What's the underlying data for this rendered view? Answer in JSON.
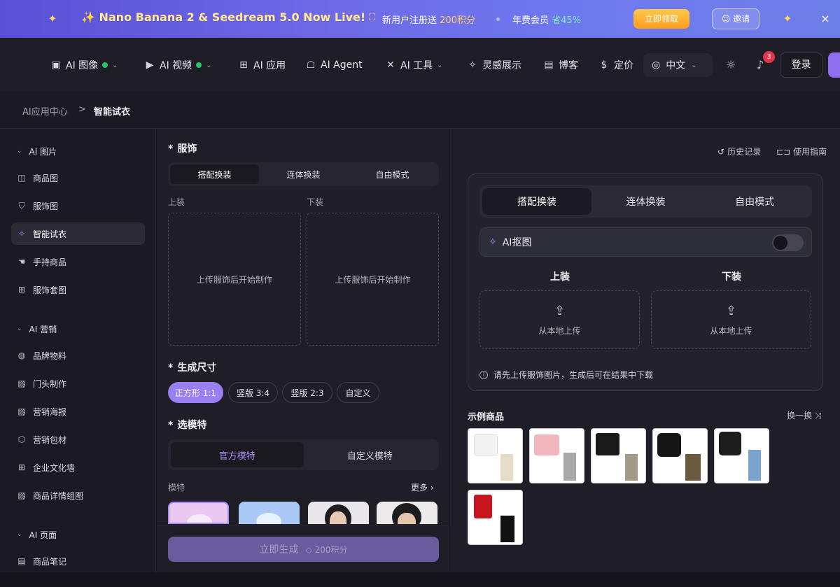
{
  "banner": {
    "title": "✨ Nano Banana 2 & Seedream 5.0 Now Live!",
    "gift_text": "新用户注册送",
    "gift_points": "200积分",
    "vip_text": "年费会员",
    "vip_discount": "省45%",
    "claim_label": "立即领取",
    "invite_label": "邀请",
    "close_icon": "×"
  },
  "nav": {
    "items": [
      {
        "label": "AI 图像",
        "icon": "image-icon"
      },
      {
        "label": "AI 视频",
        "icon": "video-icon"
      },
      {
        "label": "AI 应用",
        "icon": "apps-icon"
      },
      {
        "label": "AI Agent",
        "icon": "robot-icon"
      },
      {
        "label": "AI 工具",
        "icon": "tools-icon"
      },
      {
        "label": "灵感展示",
        "icon": "sparkle-icon"
      },
      {
        "label": "博客",
        "icon": "document-icon"
      },
      {
        "label": "定价",
        "icon": "dollar-icon"
      }
    ],
    "language": "中文",
    "notification_count": "3",
    "login_label": "登录"
  },
  "breadcrumb": {
    "parent": "AI应用中心",
    "separator": ">",
    "current": "智能试衣"
  },
  "sidebar": {
    "sections": [
      {
        "title": "AI 图片",
        "items": [
          {
            "label": "商品图",
            "icon": "bag-icon"
          },
          {
            "label": "服饰图",
            "icon": "shirt-icon"
          },
          {
            "label": "智能试衣",
            "icon": "magic-icon",
            "active": true
          },
          {
            "label": "手持商品",
            "icon": "hand-icon"
          },
          {
            "label": "服饰套图",
            "icon": "grid-icon"
          }
        ]
      },
      {
        "title": "AI 营销",
        "items": [
          {
            "label": "品牌物料",
            "icon": "palette-icon"
          },
          {
            "label": "门头制作",
            "icon": "picture-icon"
          },
          {
            "label": "营销海报",
            "icon": "picture-icon"
          },
          {
            "label": "营销包材",
            "icon": "box-icon"
          },
          {
            "label": "企业文化墙",
            "icon": "grid-icon"
          },
          {
            "label": "商品详情组图",
            "icon": "picture-icon"
          }
        ]
      },
      {
        "title": "AI 页面",
        "items": [
          {
            "label": "商品笔记",
            "icon": "note-icon"
          }
        ]
      }
    ]
  },
  "middle": {
    "clothing_label": "服饰",
    "required_mark": "*",
    "modes": [
      "搭配换装",
      "连体换装",
      "自由模式"
    ],
    "top_label": "上装",
    "bottom_label": "下装",
    "upload_hint": "上传服饰后开始制作",
    "size_label": "生成尺寸",
    "sizes": [
      "正方形 1:1",
      "竖版 3:4",
      "竖版 2:3",
      "自定义"
    ],
    "model_label": "选模特",
    "model_tabs": [
      "官方模特",
      "自定义模特"
    ],
    "model_sub": "模特",
    "more_label": "更多 ›",
    "generate_label": "立即生成",
    "generate_points": "200积分"
  },
  "right": {
    "history_label": "历史记录",
    "guide_label": "使用指南",
    "modes": [
      "搭配换装",
      "连体换装",
      "自由模式"
    ],
    "ai_cutout_label": "AI抠图",
    "ai_cutout_on": false,
    "top_label": "上装",
    "bottom_label": "下装",
    "upload_local": "从本地上传",
    "tip": "请先上传服饰图片，生成后可在结果中下载",
    "samples_title": "示例商品",
    "swap_label": "换一换 ⤨"
  },
  "colors": {
    "accent": "#9a7ff2",
    "banner_start": "#5a4fd6",
    "banner_end": "#6d7de8",
    "status_green": "#25c46a",
    "badge_red": "#e8344a"
  }
}
